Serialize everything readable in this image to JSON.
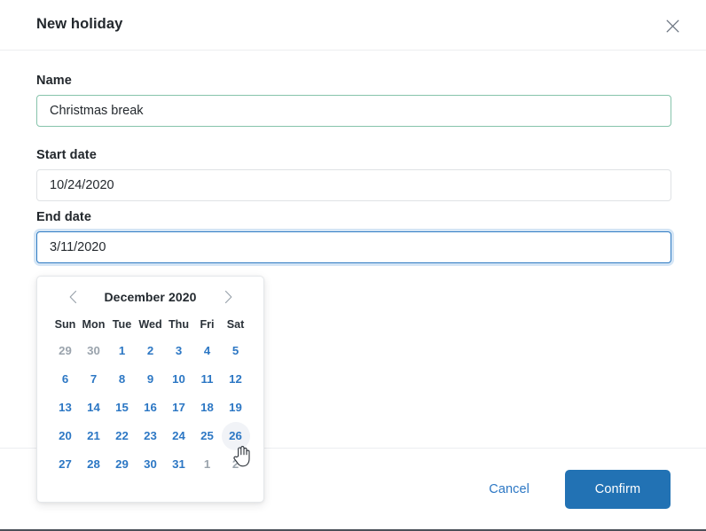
{
  "dialog": {
    "title": "New holiday",
    "close_icon": "close-icon"
  },
  "form": {
    "name": {
      "label": "Name",
      "value": "Christmas break",
      "placeholder": "",
      "state": "valid"
    },
    "start_date": {
      "label": "Start date",
      "value": "10/24/2020",
      "placeholder": "",
      "state": "default"
    },
    "end_date": {
      "label": "End date",
      "value": "3/11/2020",
      "placeholder": "",
      "state": "focused"
    }
  },
  "calendar": {
    "month_label": "December 2020",
    "prev_icon": "chevron-left-icon",
    "next_icon": "chevron-right-icon",
    "weekdays": [
      "Sun",
      "Mon",
      "Tue",
      "Wed",
      "Thu",
      "Fri",
      "Sat"
    ],
    "days": [
      {
        "label": "29",
        "muted": true,
        "hovered": false
      },
      {
        "label": "30",
        "muted": true,
        "hovered": false
      },
      {
        "label": "1",
        "muted": false,
        "hovered": false
      },
      {
        "label": "2",
        "muted": false,
        "hovered": false
      },
      {
        "label": "3",
        "muted": false,
        "hovered": false
      },
      {
        "label": "4",
        "muted": false,
        "hovered": false
      },
      {
        "label": "5",
        "muted": false,
        "hovered": false
      },
      {
        "label": "6",
        "muted": false,
        "hovered": false
      },
      {
        "label": "7",
        "muted": false,
        "hovered": false
      },
      {
        "label": "8",
        "muted": false,
        "hovered": false
      },
      {
        "label": "9",
        "muted": false,
        "hovered": false
      },
      {
        "label": "10",
        "muted": false,
        "hovered": false
      },
      {
        "label": "11",
        "muted": false,
        "hovered": false
      },
      {
        "label": "12",
        "muted": false,
        "hovered": false
      },
      {
        "label": "13",
        "muted": false,
        "hovered": false
      },
      {
        "label": "14",
        "muted": false,
        "hovered": false
      },
      {
        "label": "15",
        "muted": false,
        "hovered": false
      },
      {
        "label": "16",
        "muted": false,
        "hovered": false
      },
      {
        "label": "17",
        "muted": false,
        "hovered": false
      },
      {
        "label": "18",
        "muted": false,
        "hovered": false
      },
      {
        "label": "19",
        "muted": false,
        "hovered": false
      },
      {
        "label": "20",
        "muted": false,
        "hovered": false
      },
      {
        "label": "21",
        "muted": false,
        "hovered": false
      },
      {
        "label": "22",
        "muted": false,
        "hovered": false
      },
      {
        "label": "23",
        "muted": false,
        "hovered": false
      },
      {
        "label": "24",
        "muted": false,
        "hovered": false
      },
      {
        "label": "25",
        "muted": false,
        "hovered": false
      },
      {
        "label": "26",
        "muted": false,
        "hovered": true
      },
      {
        "label": "27",
        "muted": false,
        "hovered": false
      },
      {
        "label": "28",
        "muted": false,
        "hovered": false
      },
      {
        "label": "29",
        "muted": false,
        "hovered": false
      },
      {
        "label": "30",
        "muted": false,
        "hovered": false
      },
      {
        "label": "31",
        "muted": false,
        "hovered": false
      },
      {
        "label": "1",
        "muted": true,
        "hovered": false
      },
      {
        "label": "2",
        "muted": true,
        "hovered": false
      }
    ]
  },
  "footer": {
    "cancel_label": "Cancel",
    "confirm_label": "Confirm"
  },
  "colors": {
    "accent_blue": "#2272b4",
    "link_blue": "#2c77c4",
    "valid_green": "#86c3ab",
    "text_dark": "#22272c",
    "muted_gray": "#9aa3ac"
  }
}
